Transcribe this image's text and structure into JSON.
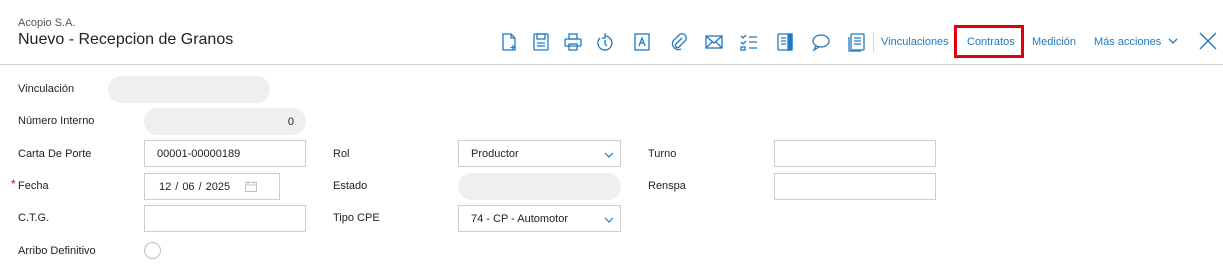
{
  "header": {
    "company": "Acopio S.A.",
    "title": "Nuevo - Recepcion de Granos"
  },
  "toolbar": {
    "icons": [
      "new-document-icon",
      "save-icon",
      "print-icon",
      "history-icon",
      "text-format-icon",
      "attachment-icon",
      "mail-icon",
      "checklist-icon",
      "notes-icon",
      "comment-icon",
      "document-list-icon"
    ],
    "links": {
      "vinculaciones": "Vinculaciones",
      "contratos": "Contratos",
      "medicion": "Medición",
      "mas_acciones": "Más acciones"
    },
    "highlight_color": "#e0000a",
    "link_color": "#1f7ac4"
  },
  "form": {
    "vinculacion": {
      "label": "Vinculación",
      "value": ""
    },
    "numero_interno": {
      "label": "Número Interno",
      "value": "0"
    },
    "carta_de_porte": {
      "label": "Carta De Porte",
      "value": "00001-00000189"
    },
    "fecha": {
      "label": "Fecha",
      "required_mark": "*",
      "day": "12",
      "month": "06",
      "year": "2025"
    },
    "ctg": {
      "label": "C.T.G.",
      "value": ""
    },
    "arribo_definitivo": {
      "label": "Arribo Definitivo",
      "checked": false
    },
    "rol": {
      "label": "Rol",
      "value": "Productor"
    },
    "estado": {
      "label": "Estado",
      "value": ""
    },
    "tipo_cpe": {
      "label": "Tipo CPE",
      "value": "74 - CP - Automotor"
    },
    "turno": {
      "label": "Turno",
      "value": ""
    },
    "renspa": {
      "label": "Renspa",
      "value": ""
    }
  }
}
